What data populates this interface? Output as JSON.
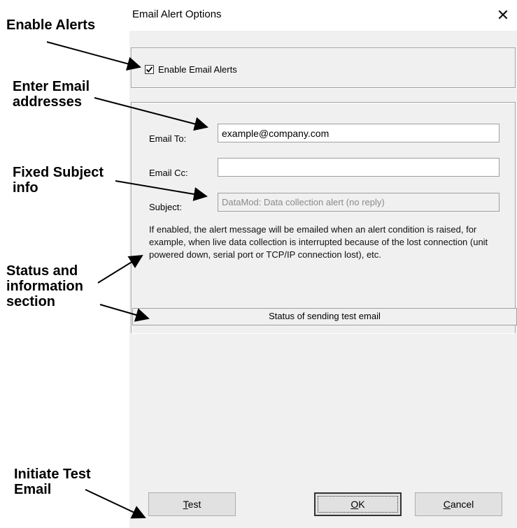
{
  "dialog": {
    "title": "Email Alert Options",
    "close_glyph": "✕",
    "enable_label": "Enable Email Alerts",
    "enable_checked": true,
    "email_to_label": "Email To:",
    "email_to_value": "example@company.com",
    "email_cc_label": "Email Cc:",
    "email_cc_value": "",
    "subject_label": "Subject:",
    "subject_value": "DataMod: Data collection alert (no reply)",
    "info_text": "If enabled, the alert message will be emailed when an alert condition is raised, for example, when live data collection is interrupted because of the lost connection (unit powered down, serial port or TCP/IP connection lost), etc.",
    "status_text": "Status of sending test email",
    "buttons": {
      "test": {
        "mnemonic": "T",
        "rest": "est"
      },
      "ok": {
        "mnemonic": "O",
        "rest": "K"
      },
      "cancel": {
        "mnemonic": "C",
        "rest": "ancel"
      }
    }
  },
  "annotations": {
    "enable_alerts": "Enable Alerts",
    "enter_email_1": "Enter Email",
    "enter_email_2": "addresses",
    "fixed_subject_1": "Fixed Subject",
    "fixed_subject_2": "info",
    "status_info_1": "Status and",
    "status_info_2": "information",
    "status_info_3": "section",
    "initiate_test_1": "Initiate Test",
    "initiate_test_2": "Email"
  }
}
